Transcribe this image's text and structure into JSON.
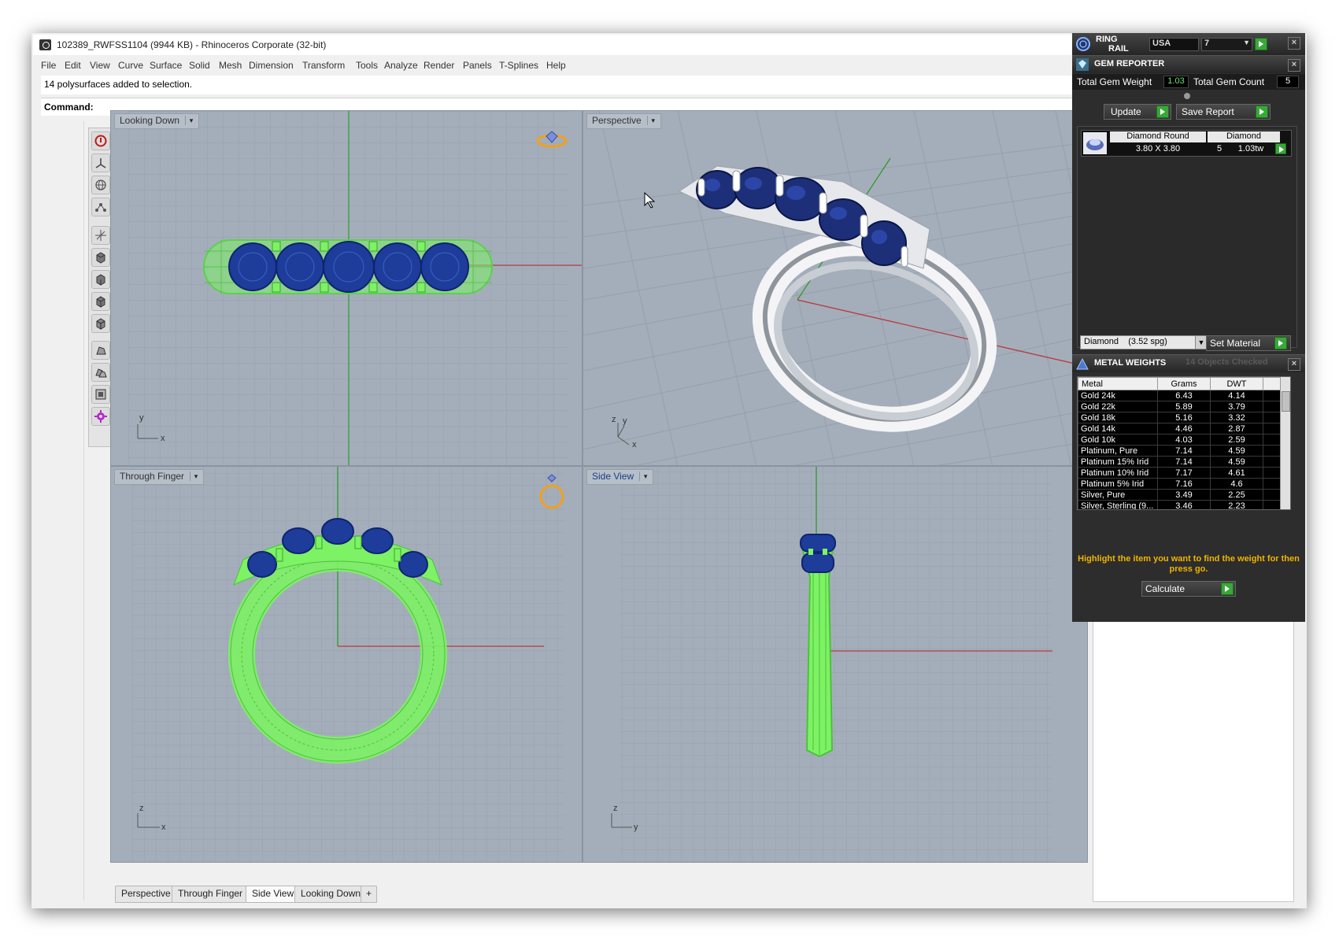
{
  "window": {
    "title": "102389_RWFSS1104 (9944 KB) - Rhinoceros Corporate (32-bit)"
  },
  "menu": [
    "File",
    "Edit",
    "View",
    "Curve",
    "Surface",
    "Solid",
    "Mesh",
    "Dimension",
    "Transform",
    "Tools",
    "Analyze",
    "Render",
    "Panels",
    "T-Splines",
    "Help"
  ],
  "command": {
    "history": "14 polysurfaces added to selection.",
    "prompt": "Command:"
  },
  "toolbar": {
    "icons": [
      "stop-icon",
      "axis-icon",
      "globe-icon",
      "nodes-icon",
      "gumball-icon",
      "box-top-icon",
      "box-front-icon",
      "box-right-icon",
      "box-persp-icon",
      "render-icon",
      "render-multi-icon",
      "zoom-window-icon",
      "gear-purple-icon"
    ]
  },
  "viewports": {
    "top_left": {
      "label": "Looking Down",
      "axis_v": "y",
      "axis_h": "x"
    },
    "top_right": {
      "label": "Perspective",
      "axis_v": "z",
      "axis_h": "x",
      "axis_d": "y"
    },
    "bottom_left": {
      "label": "Through Finger",
      "axis_v": "z",
      "axis_h": "x"
    },
    "bottom_right": {
      "label": "Side View",
      "axis_v": "z",
      "axis_h": "y"
    }
  },
  "tabs": [
    "Perspective",
    "Through Finger",
    "Side View",
    "Looking Down"
  ],
  "tabs_add": "+",
  "ring_rail": {
    "title_line1": "RING",
    "title_line2": "RAIL",
    "country": "USA",
    "size": "7",
    "close": "×"
  },
  "gem_reporter": {
    "title": "GEM REPORTER",
    "total_weight_label": "Total Gem Weight",
    "total_weight_value": "1.03",
    "total_count_label": "Total Gem Count",
    "total_count_value": "5",
    "update_label": "Update",
    "save_report_label": "Save Report",
    "gem": {
      "shape": "Diamond Round",
      "size": "3.80 X 3.80",
      "material": "Diamond",
      "count": "5",
      "weight": "1.03tw"
    },
    "material_select": "Diamond    (3.52 spg)",
    "set_material_label": "Set Material"
  },
  "metal_weights": {
    "title": "METAL WEIGHTS",
    "checked": "14 Objects Checked",
    "columns": [
      "Metal",
      "Grams",
      "DWT"
    ],
    "rows": [
      [
        "Gold 24k",
        "6.43",
        "4.14"
      ],
      [
        "Gold 22k",
        "5.89",
        "3.79"
      ],
      [
        "Gold 18k",
        "5.16",
        "3.32"
      ],
      [
        "Gold 14k",
        "4.46",
        "2.87"
      ],
      [
        "Gold 10k",
        "4.03",
        "2.59"
      ],
      [
        "Platinum, Pure",
        "7.14",
        "4.59"
      ],
      [
        "Platinum 15% Irid",
        "7.14",
        "4.59"
      ],
      [
        "Platinum 10% Irid",
        "7.17",
        "4.61"
      ],
      [
        "Platinum 5% Irid",
        "7.16",
        "4.6"
      ],
      [
        "Silver, Pure",
        "3.49",
        "2.25"
      ],
      [
        "Silver, Sterling (9...",
        "3.46",
        "2.23"
      ]
    ],
    "hint": "Highlight the item you want to find the weight for then press go.",
    "calculate_label": "Calculate"
  },
  "colors": {
    "viewport_bg": "#a4aeba",
    "wire_green": "#7cf264",
    "gem_blue": "#1e3c9a",
    "panel_bg": "#2d2d2d",
    "accent_yellow": "#f0b400",
    "value_green": "#6ee07a"
  }
}
